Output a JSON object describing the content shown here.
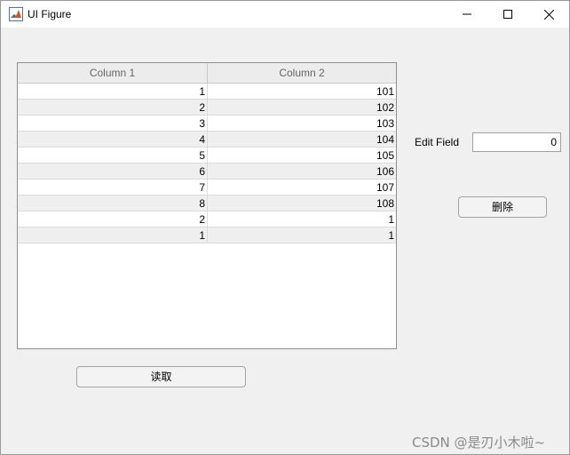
{
  "window": {
    "title": "UI Figure",
    "app_icon": "matlab-icon"
  },
  "table": {
    "columns": [
      "Column 1",
      "Column 2"
    ],
    "rows": [
      [
        "1",
        "101"
      ],
      [
        "2",
        "102"
      ],
      [
        "3",
        "103"
      ],
      [
        "4",
        "104"
      ],
      [
        "5",
        "105"
      ],
      [
        "6",
        "106"
      ],
      [
        "7",
        "107"
      ],
      [
        "8",
        "108"
      ],
      [
        "2",
        "1"
      ],
      [
        "1",
        "1"
      ]
    ]
  },
  "edit_field": {
    "label": "Edit Field",
    "value": "0"
  },
  "buttons": {
    "delete_label": "删除",
    "read_label": "读取"
  },
  "watermark": "CSDN @是刃小木啦~"
}
